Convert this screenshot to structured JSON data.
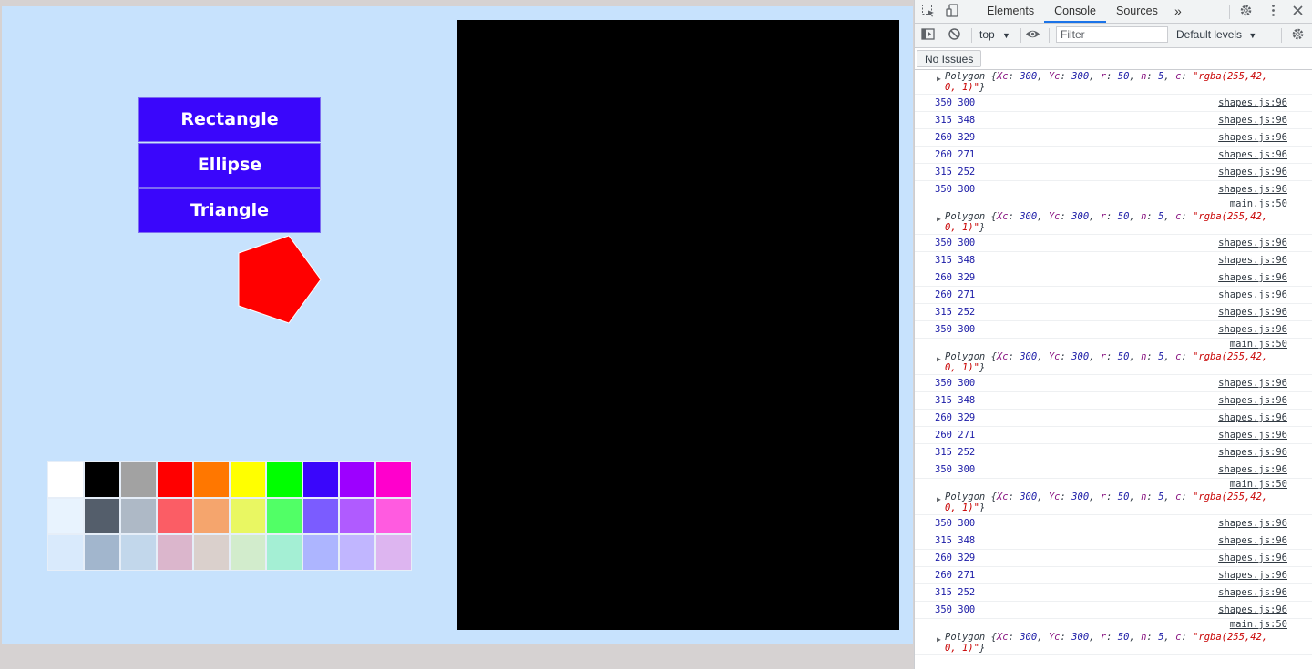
{
  "app": {
    "menu": [
      "Rectangle",
      "Ellipse",
      "Triangle"
    ],
    "shape_color": "#ff0000",
    "palette": [
      [
        "#ffffff",
        "#000000",
        "#a2a2a2",
        "#ff0000",
        "#ff7700",
        "#ffff00",
        "#00ff00",
        "#3a06fb",
        "#9d00ff",
        "#ff00cc"
      ],
      [
        "#e8f3fe",
        "#545e6b",
        "#aeb9c6",
        "#fb5d65",
        "#f5a56d",
        "#e9f762",
        "#51ff66",
        "#7b5cff",
        "#b05bff",
        "#ff5be0"
      ],
      [
        "#d9eafc",
        "#a2b6cd",
        "#c2d7eb",
        "#dbb6cc",
        "#dad0cc",
        "#d2eccc",
        "#a4efd4",
        "#adb5ff",
        "#c1b6ff",
        "#ddb5f0"
      ]
    ]
  },
  "devtools": {
    "tabs": [
      "Elements",
      "Console",
      "Sources"
    ],
    "active_tab": "Console",
    "more_tabs": "»",
    "context": "top",
    "filter_placeholder": "Filter",
    "levels": "Default levels",
    "issues_button": "No Issues",
    "log_groups": [
      {
        "source": "",
        "object": {
          "name": "Polygon",
          "Xc": "300",
          "Yc": "300",
          "r": "50",
          "n": "5",
          "c": "\"rgba(255,42,",
          "c2": "0, 1)\""
        },
        "lines": [
          "350 300",
          "315 348",
          "260 329",
          "260 271",
          "315 252",
          "350 300"
        ],
        "line_source": "shapes.js:96"
      },
      {
        "source": "main.js:50",
        "object": {
          "name": "Polygon",
          "Xc": "300",
          "Yc": "300",
          "r": "50",
          "n": "5",
          "c": "\"rgba(255,42,",
          "c2": "0, 1)\""
        },
        "lines": [
          "350 300",
          "315 348",
          "260 329",
          "260 271",
          "315 252",
          "350 300"
        ],
        "line_source": "shapes.js:96"
      },
      {
        "source": "main.js:50",
        "object": {
          "name": "Polygon",
          "Xc": "300",
          "Yc": "300",
          "r": "50",
          "n": "5",
          "c": "\"rgba(255,42,",
          "c2": "0, 1)\""
        },
        "lines": [
          "350 300",
          "315 348",
          "260 329",
          "260 271",
          "315 252",
          "350 300"
        ],
        "line_source": "shapes.js:96"
      },
      {
        "source": "main.js:50",
        "object": {
          "name": "Polygon",
          "Xc": "300",
          "Yc": "300",
          "r": "50",
          "n": "5",
          "c": "\"rgba(255,42,",
          "c2": "0, 1)\""
        },
        "lines": [
          "350 300",
          "315 348",
          "260 329",
          "260 271",
          "315 252",
          "350 300"
        ],
        "line_source": "shapes.js:96"
      },
      {
        "source": "main.js:50",
        "object": {
          "name": "Polygon",
          "Xc": "300",
          "Yc": "300",
          "r": "50",
          "n": "5",
          "c": "\"rgba(255,42,",
          "c2": "0, 1)\""
        },
        "lines": [],
        "line_source": "shapes.js:96"
      }
    ]
  }
}
